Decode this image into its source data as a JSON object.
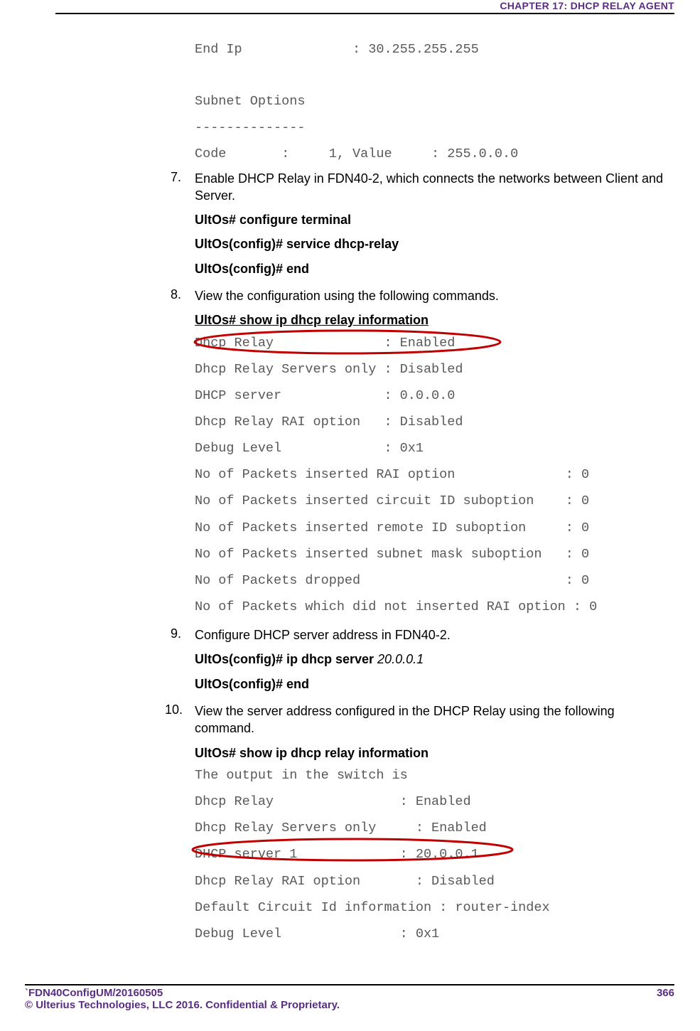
{
  "header": {
    "chapter": "CHAPTER 17: DHCP RELAY AGENT"
  },
  "topblock": {
    "line1": "End Ip              : 30.255.255.255",
    "blank": "",
    "subhead": "Subnet Options",
    "dashes": "--------------",
    "codeline": "Code       :     1, Value     : 255.0.0.0"
  },
  "step7": {
    "num": "7.",
    "text": "Enable DHCP Relay in FDN40-2, which connects the networks between Client and Server.",
    "cmd1": "UltOs# configure terminal",
    "cmd2": "UltOs(config)# service dhcp-relay",
    "cmd3": "UltOs(config)# end"
  },
  "step8": {
    "num": "8.",
    "text": "View the configuration using the following commands.",
    "cmdshow": "UltOs# show ip dhcp relay information",
    "l1": "Dhcp Relay              : Enabled",
    "l2": "Dhcp Relay Servers only : Disabled",
    "l3": "DHCP server             : 0.0.0.0",
    "l4": "Dhcp Relay RAI option   : Disabled",
    "l5": "Debug Level             : 0x1",
    "l6": "No of Packets inserted RAI option              : 0",
    "l7": "No of Packets inserted circuit ID suboption    : 0",
    "l8": "No of Packets inserted remote ID suboption     : 0",
    "l9": "No of Packets inserted subnet mask suboption   : 0",
    "l10": "No of Packets dropped                          : 0",
    "l11": "No of Packets which did not inserted RAI option : 0"
  },
  "step9": {
    "num": "9.",
    "text": "Configure DHCP server address in FDN40-2.",
    "cmd1_prefix": "UltOs(config)# ip dhcp server ",
    "cmd1_arg": "20.0.0.1",
    "cmd2": "UltOs(config)# end"
  },
  "step10": {
    "num": "10.",
    "text": "View the server address configured in the DHCP Relay using the following command.",
    "cmdshow": "UltOs# show ip dhcp relay information",
    "l1": "The output in the switch is",
    "l2": "Dhcp Relay                : Enabled",
    "l3": "Dhcp Relay Servers only     : Enabled",
    "l4": "DHCP server 1             : 20.0.0.1",
    "l5": "Dhcp Relay RAI option       : Disabled",
    "l6": "Default Circuit Id information : router-index",
    "l7": "Debug Level               : 0x1"
  },
  "footer": {
    "docid": "`FDN40ConfigUM/20160505",
    "page": "366",
    "copyright": "© Ulterius Technologies, LLC 2016. Confidential & Proprietary."
  }
}
